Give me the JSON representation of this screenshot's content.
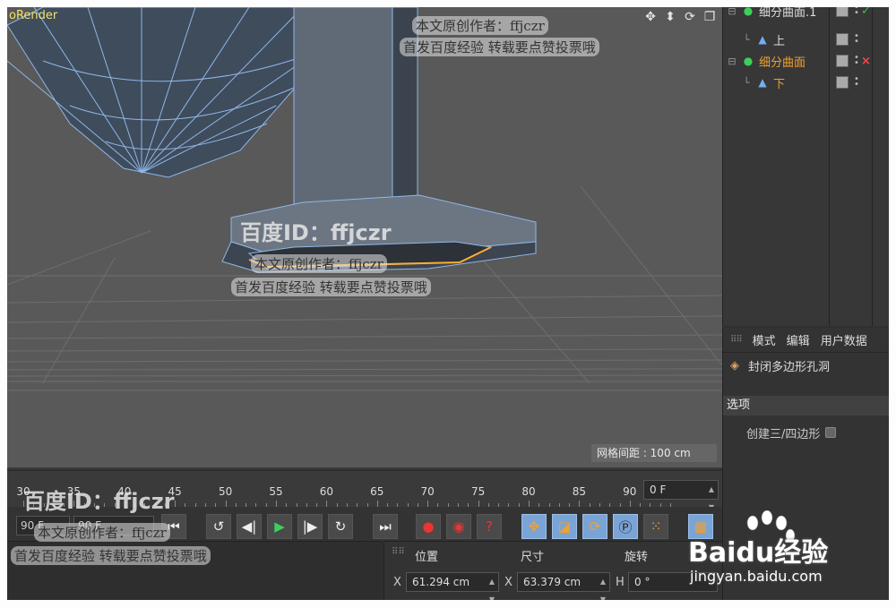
{
  "viewport": {
    "title": "oRender",
    "grid_spacing": "网格间距 : 100 cm",
    "nav_icons": [
      "move-icon",
      "pan-icon",
      "rotate-icon",
      "maximize-icon"
    ]
  },
  "object_manager": {
    "rows": [
      {
        "label": "细分曲面.1",
        "icon": "subdivision-icon",
        "mark": "✓",
        "mark_color": "#2ecc40"
      },
      {
        "label": "上",
        "icon": "polygon-object-icon",
        "mark": "",
        "mark_color": ""
      },
      {
        "label": "细分曲面",
        "icon": "subdivision-icon",
        "mark": "×",
        "mark_color": "#ff4444"
      },
      {
        "label": "下",
        "icon": "polygon-object-icon",
        "mark": "",
        "mark_color": ""
      }
    ]
  },
  "attributes": {
    "tabs": [
      "模式",
      "编辑",
      "用户数据"
    ],
    "object_name": "封闭多边形孔洞",
    "section": "选项",
    "option_label": "创建三/四边形"
  },
  "timeline": {
    "ticks": [
      "30",
      "35",
      "40",
      "45",
      "50",
      "55",
      "60",
      "65",
      "70",
      "75",
      "80",
      "85",
      "90"
    ],
    "current_frame": "0 F"
  },
  "transport": {
    "start_field": "90 F",
    "end_field": "90 F"
  },
  "coordinates": {
    "headers": {
      "position": "位置",
      "size": "尺寸",
      "rotation": "旋转"
    },
    "x_label": "X",
    "x_position": "61.294 cm",
    "x_size_label": "X",
    "x_size": "63.379 cm",
    "h_label": "H",
    "h_rotation": "0 °"
  },
  "watermarks": {
    "id_text": "百度ID：ffjczr",
    "author": "本文原创作者：ffjczr",
    "notice": "首发百度经验  转载要点赞投票哦",
    "brand": "Baidu经验",
    "url": "jingyan.baidu.com"
  },
  "colors": {
    "viewport_bg": "#595959",
    "selection_orange": "#ffae2e",
    "wire_blue": "#8fb7e8",
    "title_yellow": "#f1e36d",
    "highlight_orange": "#f0a030"
  }
}
